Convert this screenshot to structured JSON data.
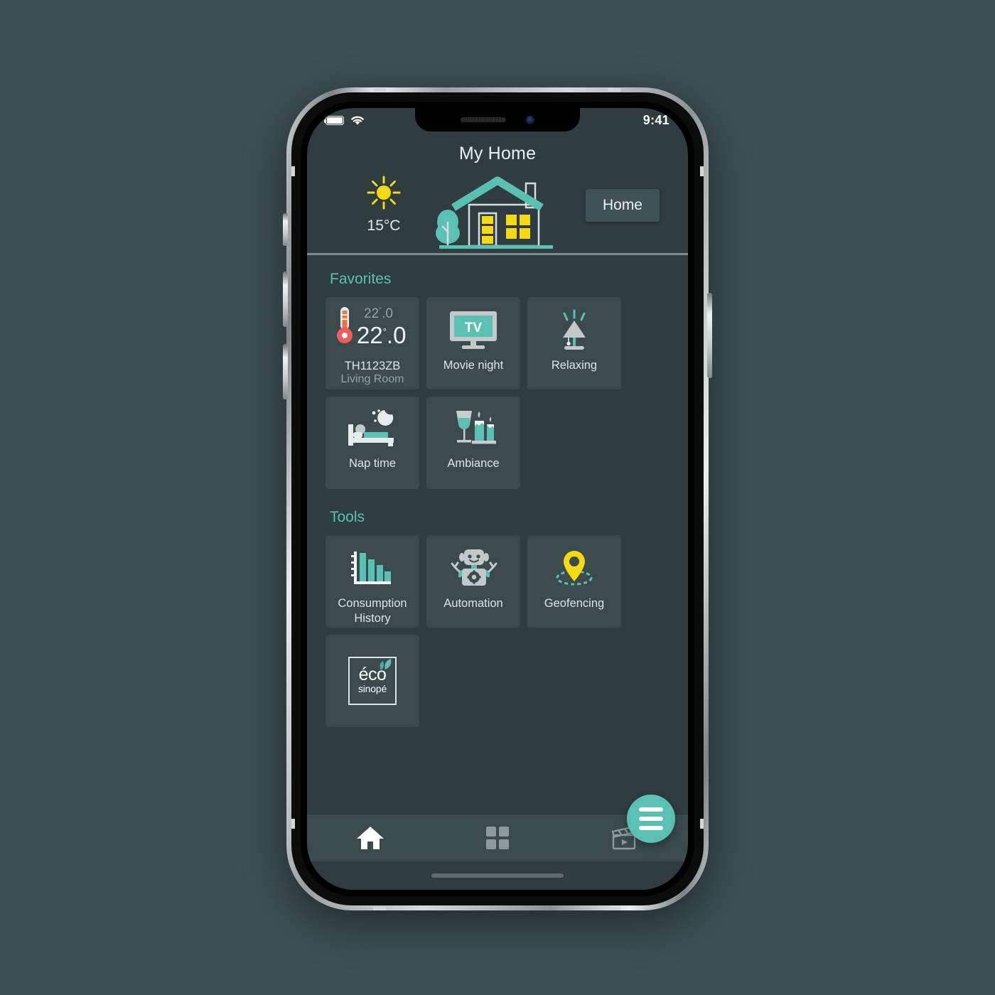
{
  "status_bar": {
    "time": "9:41",
    "battery_icon": "battery-full-icon",
    "wifi_icon": "wifi-icon"
  },
  "header": {
    "title": "My Home",
    "weather": {
      "icon": "sun-icon",
      "temperature": "15°C"
    },
    "illustration": "house-illustration",
    "location_button": "Home"
  },
  "sections": {
    "favorites_title": "Favorites",
    "tools_title": "Tools"
  },
  "favorites": [
    {
      "type": "thermostat",
      "icon": "thermometer-icon",
      "setpoint": "22",
      "setpoint_decimal": ".0",
      "current": "22",
      "current_decimal": ".0",
      "degree": "°",
      "device": "TH1123ZB",
      "room": "Living Room"
    },
    {
      "type": "scene",
      "icon": "tv-icon",
      "icon_text": "TV",
      "label": "Movie night"
    },
    {
      "type": "scene",
      "icon": "lamp-icon",
      "label": "Relaxing"
    },
    {
      "type": "scene",
      "icon": "bed-moon-icon",
      "label": "Nap time"
    },
    {
      "type": "scene",
      "icon": "wine-candles-icon",
      "label": "Ambiance"
    }
  ],
  "tools": [
    {
      "icon": "bar-chart-icon",
      "label": "Consumption History"
    },
    {
      "icon": "robot-icon",
      "label": "Automation"
    },
    {
      "icon": "map-pin-icon",
      "label": "Geofencing"
    },
    {
      "icon": "eco-sinope-logo",
      "logo_main": "éco",
      "logo_sub": "sinopé",
      "label": ""
    }
  ],
  "tabbar": {
    "items": [
      {
        "icon": "home-icon",
        "active": true
      },
      {
        "icon": "grid-icon",
        "active": false
      },
      {
        "icon": "clapperboard-icon",
        "active": false
      }
    ],
    "fab_icon": "hamburger-menu-icon"
  },
  "colors": {
    "background": "#2f3d40",
    "card": "#3a4a4d",
    "accent_teal": "#5bc0b4",
    "accent_yellow": "#f5d913",
    "text_primary": "#e9eeee",
    "text_muted": "#98a3a3"
  }
}
